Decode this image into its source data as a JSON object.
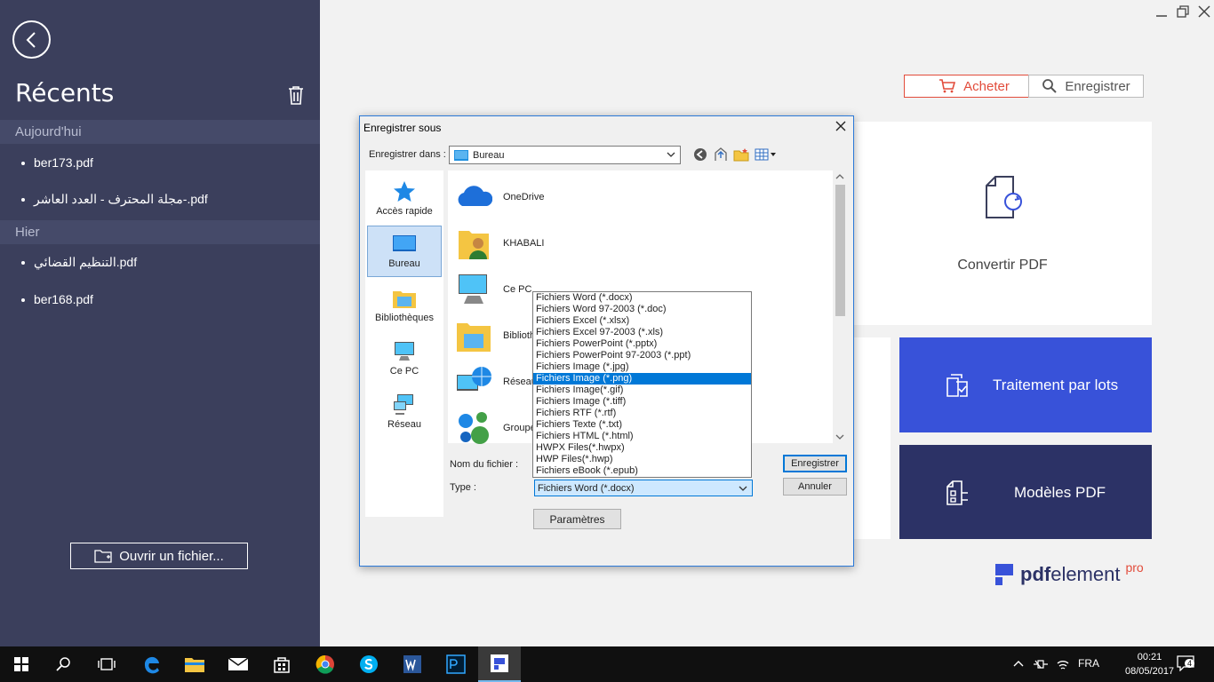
{
  "sidebar": {
    "title": "Récents",
    "groups": [
      {
        "label": "Aujourd'hui",
        "items": [
          "ber173.pdf",
          "مجلة المحترف - العدد العاشر-.pdf"
        ]
      },
      {
        "label": "Hier",
        "items": [
          "التنظيم القضائي.pdf",
          "ber168.pdf"
        ]
      }
    ],
    "open_file_label": "Ouvrir un fichier..."
  },
  "header": {
    "buy_label": "Acheter",
    "register_label": "Enregistrer"
  },
  "cards": {
    "convert_label": "Convertir PDF",
    "batch_label": "Traitement par lots",
    "templates_label": "Modèles PDF"
  },
  "brand": {
    "bold": "pdf",
    "light": "element",
    "suffix": "pro"
  },
  "dialog": {
    "title": "Enregistrer sous",
    "save_in_label": "Enregistrer dans :",
    "save_in_value": "Bureau",
    "places": [
      "Accès rapide",
      "Bureau",
      "Bibliothèques",
      "Ce PC",
      "Réseau"
    ],
    "files": [
      "OneDrive",
      "KHABALI",
      "Ce PC",
      "Biblioth",
      "Réseau",
      "Groupe"
    ],
    "filename_label": "Nom du fichier :",
    "type_label": "Type :",
    "type_value": "Fichiers Word (*.docx)",
    "save_button": "Enregistrer",
    "cancel_button": "Annuler",
    "params_button": "Paramètres",
    "type_options": [
      "Fichiers Word (*.docx)",
      "Fichiers Word 97-2003 (*.doc)",
      "Fichiers Excel (*.xlsx)",
      "Fichiers Excel 97-2003 (*.xls)",
      "Fichiers PowerPoint (*.pptx)",
      "Fichiers PowerPoint 97-2003 (*.ppt)",
      "Fichiers Image (*.jpg)",
      "Fichiers Image (*.png)",
      "Fichiers Image(*.gif)",
      "Fichiers Image (*.tiff)",
      "Fichiers RTF (*.rtf)",
      "Fichiers Texte (*.txt)",
      "Fichiers HTML (*.html)",
      "HWPX Files(*.hwpx)",
      "HWP Files(*.hwp)",
      "Fichiers eBook  (*.epub)"
    ],
    "selected_option_index": 7
  },
  "taskbar": {
    "language": "FRA",
    "time": "00:21",
    "date": "08/05/2017",
    "notification_count": "4"
  },
  "colors": {
    "sidebar_bg": "#3b3f5c",
    "accent_red": "#e24c3b",
    "batch_blue": "#3852d9",
    "templates_navy": "#2c3266",
    "selection_blue": "#0078d7"
  }
}
